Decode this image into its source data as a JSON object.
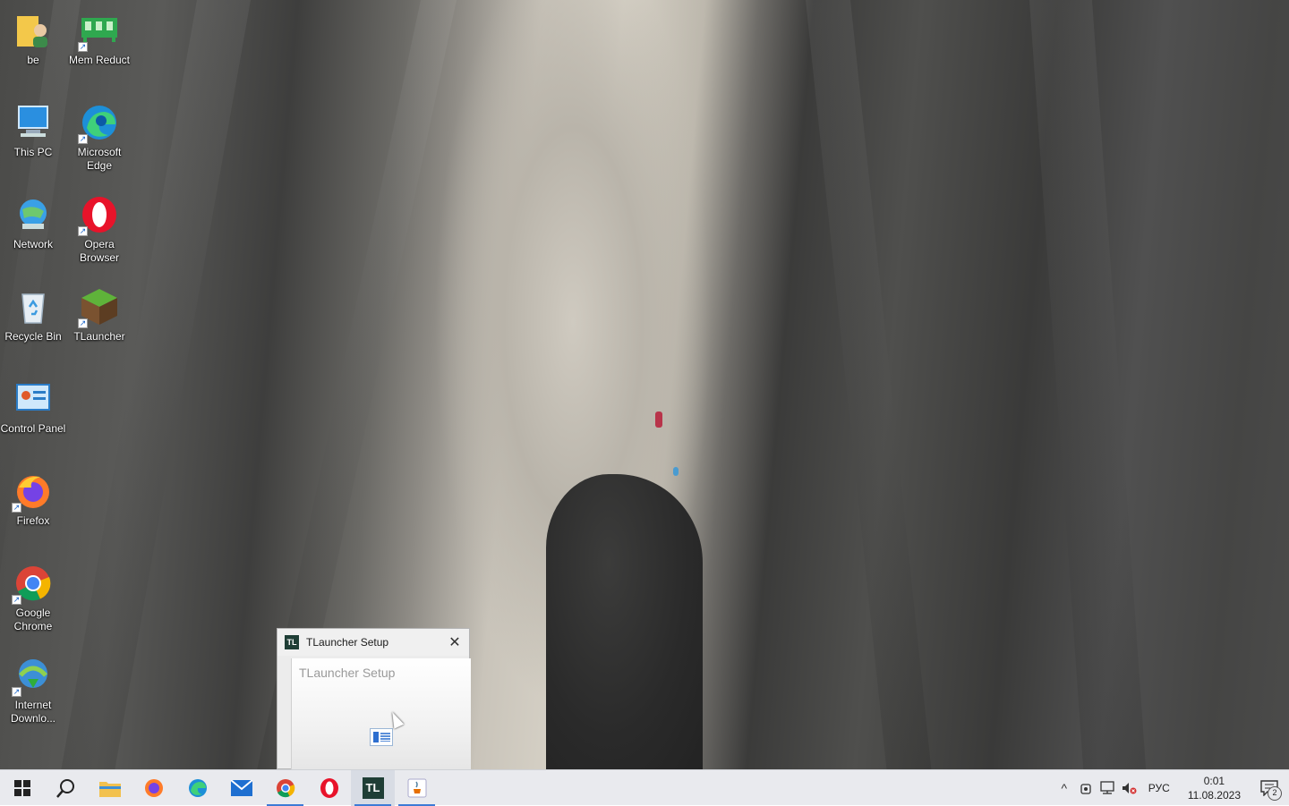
{
  "desktop_icons": [
    {
      "label": "be",
      "icon": "user-folder-icon"
    },
    {
      "label": "Mem Reduct",
      "icon": "mem-reduct-icon"
    },
    {
      "label": "This PC",
      "icon": "this-pc-icon"
    },
    {
      "label": "Microsoft Edge",
      "icon": "edge-icon"
    },
    {
      "label": "Network",
      "icon": "network-icon"
    },
    {
      "label": "Opera Browser",
      "icon": "opera-icon"
    },
    {
      "label": "Recycle Bin",
      "icon": "recycle-bin-icon"
    },
    {
      "label": "TLauncher",
      "icon": "tlauncher-icon"
    },
    {
      "label": "Control Panel",
      "icon": "control-panel-icon"
    },
    {
      "label": "Firefox",
      "icon": "firefox-icon"
    },
    {
      "label": "Google Chrome",
      "icon": "chrome-icon"
    },
    {
      "label": "Internet Downlo...",
      "icon": "idm-icon"
    }
  ],
  "setup_window": {
    "title": "TLauncher Setup",
    "app_icon_text": "TL",
    "heading": "TLauncher Setup",
    "close_glyph": "✕"
  },
  "taskbar": {
    "apps": [
      "start",
      "search",
      "file-explorer",
      "firefox",
      "edge",
      "mail",
      "chrome",
      "opera",
      "tlauncher",
      "java"
    ],
    "tlauncher_text": "TL"
  },
  "tray": {
    "chevron": "^",
    "language": "РУС",
    "time": "0:01",
    "date": "11.08.2023",
    "notification_count": "2"
  },
  "colors": {
    "taskbar_bg": "#e9eaee",
    "active_indicator": "#3d7bd6"
  }
}
